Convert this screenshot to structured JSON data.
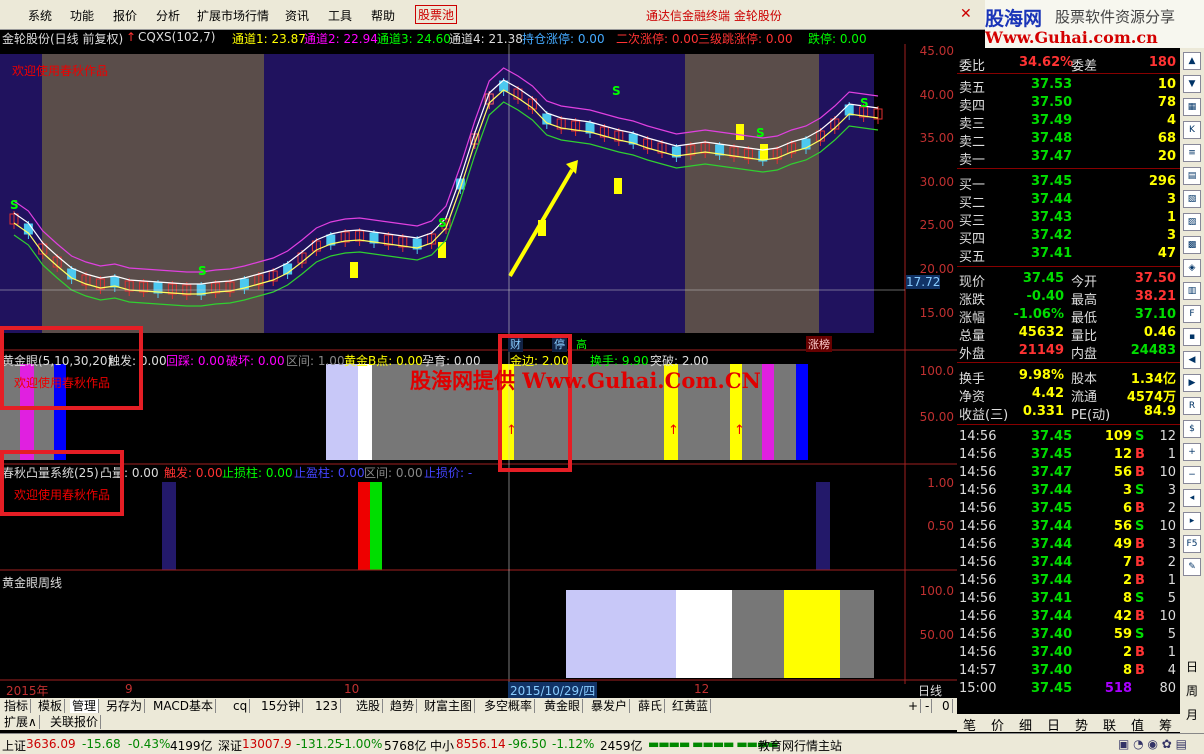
{
  "menu": {
    "items": [
      "系统",
      "功能",
      "报价",
      "分析",
      "扩展市场行情",
      "资讯",
      "工具",
      "帮助"
    ],
    "stock_pool": "股票池",
    "broker": "通达信金融终端  金轮股份"
  },
  "logo": {
    "big": "股海网",
    "tag": "股票软件资源分享",
    "url": "Www.Guhai.com.cn"
  },
  "header": {
    "stock": "金轮股份(日线 前复权)",
    "indicator": "CQXS(102,7)",
    "ch1": "通道1: 23.87",
    "ch2": "通道2: 22.94",
    "ch3": "通道3: 24.60",
    "ch4": "通道4: 21.38",
    "hold": "持仓涨停: 0.00",
    "second": "二次涨停: 0.00",
    "third": "三级跳涨停: 0.00",
    "limitdown": "跌停: 0.00"
  },
  "main_chart": {
    "welcome": "欢迎使用春秋作品",
    "yaxis": [
      "45.00",
      "40.00",
      "35.00",
      "30.00",
      "25.00",
      "20.00",
      "15.00"
    ],
    "cursor_price": "17.72",
    "tags": {
      "cai": "财",
      "ting": "停",
      "gao": "高",
      "zhangbang": "涨榜"
    },
    "s_marks": [
      "S",
      "S",
      "S",
      "S",
      "S",
      "S"
    ]
  },
  "panel2": {
    "title": "黄金眼(5,10,30,20)",
    "trigger": "触发: 0.00",
    "pullback": "回踩: 0.00",
    "break": "破坏: 0.00",
    "zone": "区间: 1.00",
    "gold_b": "黄金B点: 0.00",
    "pregnant": "孕育: 0.00",
    "golden_edge": "金边: 2.00",
    "turnover": "换手: 9.90",
    "breakthrough": "突破: 2.00",
    "welcome": "欢迎使用春秋作品",
    "yaxis": [
      "100.0",
      "50.00"
    ]
  },
  "panel3": {
    "title": "春秋凸量系统(25)",
    "tu": "凸量: 0.00",
    "trigger": "触发: 0.00",
    "stop_bar": "止损柱: 0.00",
    "stop_pan": "止盈柱: 0.00",
    "zone": "区间: 0.00",
    "stop_price": "止损价: -",
    "welcome": "欢迎使用春秋作品",
    "yaxis": [
      "1.00",
      "0.50"
    ]
  },
  "panel4": {
    "title": "黄金眼周线",
    "yaxis": [
      "100.0",
      "50.00"
    ]
  },
  "timeline": {
    "year": "2015年",
    "m9": "9",
    "m10": "10",
    "cursor_date": "2015/10/29/四",
    "m12": "12",
    "period": "日线"
  },
  "watermark": "股海网提供 Www.Guhai.Com.CN",
  "quote": {
    "weibi": {
      "label": "委比",
      "val": "34.62%",
      "label2": "委差",
      "val2": "180"
    },
    "asks": [
      {
        "l": "卖五",
        "p": "37.53",
        "v": "10"
      },
      {
        "l": "卖四",
        "p": "37.50",
        "v": "78"
      },
      {
        "l": "卖三",
        "p": "37.49",
        "v": "4"
      },
      {
        "l": "卖二",
        "p": "37.48",
        "v": "68"
      },
      {
        "l": "卖一",
        "p": "37.47",
        "v": "20"
      }
    ],
    "bids": [
      {
        "l": "买一",
        "p": "37.45",
        "v": "296"
      },
      {
        "l": "买二",
        "p": "37.44",
        "v": "3"
      },
      {
        "l": "买三",
        "p": "37.43",
        "v": "1"
      },
      {
        "l": "买四",
        "p": "37.42",
        "v": "3"
      },
      {
        "l": "买五",
        "p": "37.41",
        "v": "47"
      }
    ],
    "stats": [
      {
        "l": "现价",
        "v": "37.45",
        "l2": "今开",
        "v2": "37.50"
      },
      {
        "l": "涨跌",
        "v": "-0.40",
        "l2": "最高",
        "v2": "38.21"
      },
      {
        "l": "涨幅",
        "v": "-1.06%",
        "l2": "最低",
        "v2": "37.10"
      },
      {
        "l": "总量",
        "v": "45632",
        "l2": "量比",
        "v2": "0.46"
      },
      {
        "l": "外盘",
        "v": "21149",
        "l2": "内盘",
        "v2": "24483"
      }
    ],
    "stats2": [
      {
        "l": "换手",
        "v": "9.98%",
        "l2": "股本",
        "v2": "1.34亿"
      },
      {
        "l": "净资",
        "v": "4.42",
        "l2": "流通",
        "v2": "4574万"
      },
      {
        "l": "收益(三)",
        "v": "0.331",
        "l2": "PE(动)",
        "v2": "84.9"
      }
    ],
    "ticks": [
      {
        "t": "14:56",
        "p": "37.45",
        "v": "109",
        "s": "S",
        "n": "12"
      },
      {
        "t": "14:56",
        "p": "37.45",
        "v": "12",
        "s": "B",
        "n": "1"
      },
      {
        "t": "14:56",
        "p": "37.47",
        "v": "56",
        "s": "B",
        "n": "10"
      },
      {
        "t": "14:56",
        "p": "37.44",
        "v": "3",
        "s": "S",
        "n": "3"
      },
      {
        "t": "14:56",
        "p": "37.45",
        "v": "6",
        "s": "B",
        "n": "2"
      },
      {
        "t": "14:56",
        "p": "37.44",
        "v": "56",
        "s": "S",
        "n": "10"
      },
      {
        "t": "14:56",
        "p": "37.44",
        "v": "49",
        "s": "B",
        "n": "3"
      },
      {
        "t": "14:56",
        "p": "37.44",
        "v": "7",
        "s": "B",
        "n": "2"
      },
      {
        "t": "14:56",
        "p": "37.44",
        "v": "2",
        "s": "B",
        "n": "1"
      },
      {
        "t": "14:56",
        "p": "37.41",
        "v": "8",
        "s": "S",
        "n": "5"
      },
      {
        "t": "14:56",
        "p": "37.44",
        "v": "42",
        "s": "B",
        "n": "10"
      },
      {
        "t": "14:56",
        "p": "37.40",
        "v": "59",
        "s": "S",
        "n": "5"
      },
      {
        "t": "14:56",
        "p": "37.40",
        "v": "2",
        "s": "B",
        "n": "1"
      },
      {
        "t": "14:57",
        "p": "37.40",
        "v": "8",
        "s": "B",
        "n": "4"
      },
      {
        "t": "15:00",
        "p": "37.45",
        "v": "518",
        "s": "",
        "n": "80"
      }
    ]
  },
  "tabs": [
    "指标",
    "模板",
    "管理",
    "另存为",
    "MACD基本",
    "cq",
    "15分钟",
    "123",
    "选股",
    "趋势",
    "财富主图",
    "多空概率",
    "黄金眼",
    "暴发户",
    "薛氏",
    "红黄蓝"
  ],
  "tabs2": [
    "扩展∧",
    "关联报价"
  ],
  "tab_ctrl": [
    "+",
    "-",
    "0"
  ],
  "right_tabs": [
    "笔",
    "价",
    "细",
    "日",
    "势",
    "联",
    "值",
    "筹"
  ],
  "status": {
    "sh_label": "上证",
    "sh": "3636.09",
    "sh_chg": "-15.68",
    "sh_pct": "-0.43%",
    "sh_amt": "4199亿",
    "sz_label": "深证",
    "sz": "13007.9",
    "sz_chg": "-131.25",
    "sz_pct": "-1.00%",
    "sz_amt": "5768亿",
    "zx_label": "中小",
    "zx": "8556.14",
    "zx_chg": "-96.50",
    "zx_pct": "-1.12%",
    "zx_amt": "2459亿",
    "site": "教育网行情主站"
  },
  "side_icons": [
    "up-arrow-icon",
    "down-arrow-icon",
    "book-icon",
    "k-icon",
    "list-icon",
    "grid-icon",
    "doc-icon",
    "fin-icon",
    "sheet-icon",
    "fund-icon",
    "chart-icon",
    "f10-icon",
    "news-icon",
    "prev-icon",
    "next-icon",
    "rsi-icon",
    "money-icon",
    "plus-icon",
    "minus-icon",
    "left-icon",
    "right-icon",
    "f5-icon",
    "tool-icon"
  ],
  "side_text": [
    "日",
    "周",
    "月"
  ]
}
